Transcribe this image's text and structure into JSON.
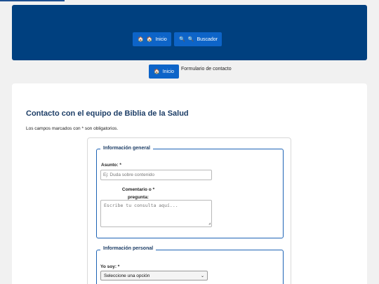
{
  "nav": {
    "home_label": "Inicio",
    "search_label": "Buscador"
  },
  "breadcrumb": {
    "home_label": "Inicio",
    "current": "Formulario de contacto"
  },
  "page": {
    "title": "Contacto con el equipo de Biblia de la Salud",
    "required_note": "Los campos marcados con * son obligatorios."
  },
  "form": {
    "general": {
      "legend": "Información general",
      "subject_label": "Asunto: *",
      "subject_placeholder": "Ej: Duda sobre contenido",
      "comment_label_line1": "Comentario o",
      "comment_label_line2": "pregunta:",
      "comment_required_mark": "*",
      "comment_placeholder": "Escribe tu consulta aquí..."
    },
    "personal": {
      "legend": "Información personal",
      "iam_label": "Yo soy: *",
      "iam_selected": "Seleccione una opción"
    }
  },
  "icons": {
    "home": "🏠",
    "search": "🔍"
  },
  "colors": {
    "header_bg": "#00407f",
    "button_bg": "#0d64c8",
    "title": "#1c3d66",
    "fieldset_border": "#1d63b5"
  }
}
